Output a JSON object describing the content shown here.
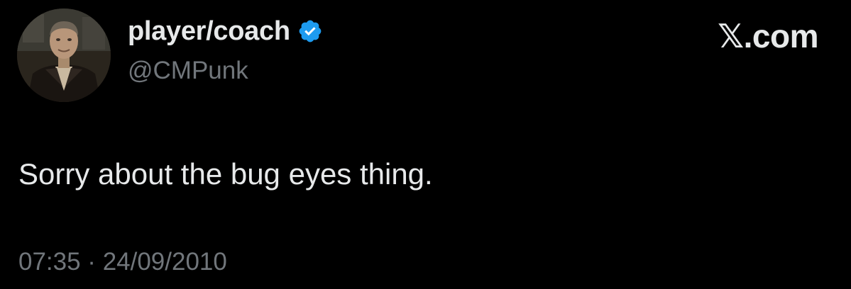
{
  "author": {
    "display_name": "player/coach",
    "handle": "@CMPunk",
    "verified": true,
    "verified_icon": "verified-badge-icon",
    "verified_color": "#1d9bf0"
  },
  "site": {
    "label": "𝕏.com"
  },
  "tweet": {
    "text": "Sorry about the bug eyes thing.",
    "timestamp": "07:35 · 24/09/2010"
  },
  "colors": {
    "background": "#000000",
    "primary_text": "#e7e9ea",
    "secondary_text": "#71767b"
  }
}
